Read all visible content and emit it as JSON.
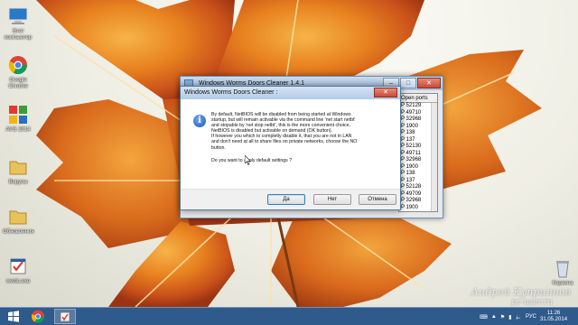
{
  "desktop": {
    "icons": [
      {
        "label": "Этот компьютер",
        "icon": "computer-icon"
      },
      {
        "label": "Google Chrome",
        "icon": "chrome-icon"
      },
      {
        "label": "AVG 2014",
        "icon": "avg-icon"
      },
      {
        "label": "Вирусы",
        "icon": "folder-icon"
      },
      {
        "label": "Обновления",
        "icon": "folder-icon"
      },
      {
        "label": "wwdc.exe",
        "icon": "exe-icon"
      }
    ],
    "recycle_bin_label": "Корзина"
  },
  "background_window": {
    "title": "Windows Worms Doors Cleaner 1.4.1",
    "ports_header": "Open ports",
    "ports": [
      "P 52129",
      "P 49710",
      "P 32968",
      "P 1900",
      "P 138",
      "P 137",
      "P 52130",
      "P 49711",
      "P 32968",
      "P 1900",
      "P 138",
      "P 137",
      "P 52128",
      "P 49709",
      "P 32968",
      "P 1900"
    ]
  },
  "dialog": {
    "title": "Windows Worms Doors Cleaner :",
    "message": "By default, NetBIOS will be disabled from being started at Windows\nstartup, but will remain activable via the command line 'net start netbt'\nand stopable by 'net stop netbt', this is the more convenient choice,\nNetBIOS is disabled but activable on demand (OK button).\nIf however you which to completly disable it, that you are not in LAN\nand don't need at all to share files on private networks, choose the NO\nbutton.",
    "question": "Do you want to apply default settings ?",
    "buttons": {
      "yes": "Да",
      "no": "Нет",
      "cancel": "Отмена"
    }
  },
  "watermark": {
    "author": "Андрей Куприянов",
    "site": "pc-user.ru"
  },
  "taskbar": {
    "language": "РУС",
    "time": "11:26",
    "date": "31.05.2014"
  },
  "colors": {
    "taskbar": "#2e5a8c",
    "dialog_border": "#55799e",
    "leaf_orange": "#e07a1c"
  }
}
